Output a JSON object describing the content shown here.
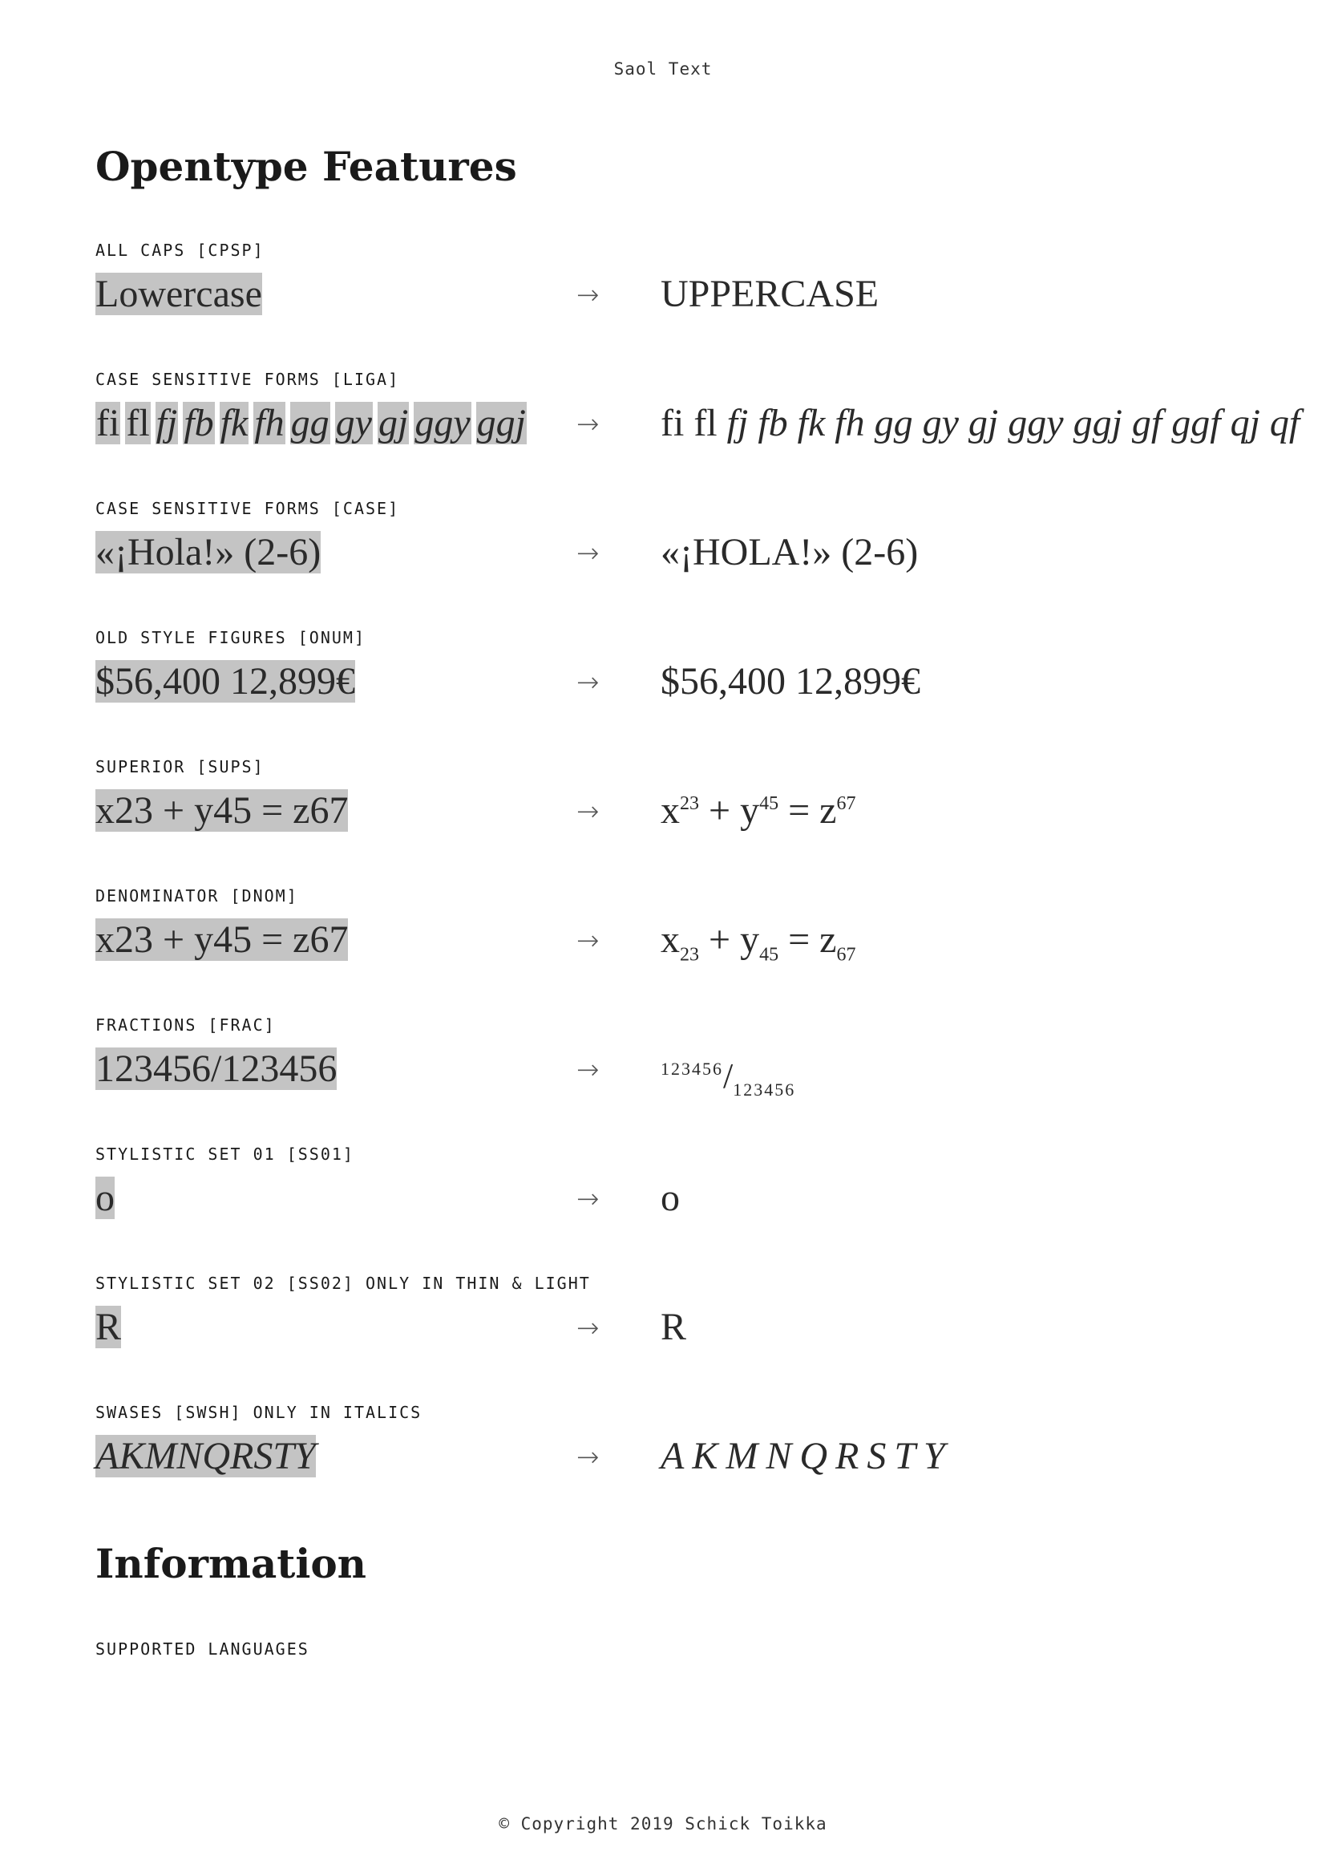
{
  "header": {
    "title": "Saol Text"
  },
  "sections": {
    "opentype": {
      "heading": "Opentype Features"
    },
    "information": {
      "heading": "Information",
      "languages_label": "SUPPORTED LANGUAGES"
    }
  },
  "arrow": "→",
  "features": [
    {
      "label": "ALL CAPS [CPSP]",
      "sample": "Lowercase",
      "result": "UPPERCASE"
    },
    {
      "label": "CASE SENSITIVE FORMS [LIGA]",
      "sample_parts": [
        "fi",
        "fl",
        "fj",
        "fb",
        "fk",
        "fh",
        "gg",
        "gy",
        "gj",
        "ggy",
        "ggj"
      ],
      "result_roman": "fi fl ",
      "result_italic": "fj fb fk fh gg gy gj ggy ggj gf ggf qj qf"
    },
    {
      "label": "CASE SENSITIVE FORMS [CASE]",
      "sample": "«¡Hola!» (2-6)",
      "result": "«¡HOLA!» (2-6)"
    },
    {
      "label": "OLD STYLE FIGURES [ONUM]",
      "sample": "$56,400 12,899€",
      "result": "$56,400 12,899€"
    },
    {
      "label": "SUPERIOR [SUPS]",
      "sample": "x23 + y45 = z67",
      "result_parts": {
        "a": "x",
        "a_sup": "23",
        "op1": " + ",
        "b": "y",
        "b_sup": "45",
        "op2": " = ",
        "c": "z",
        "c_sup": "67"
      }
    },
    {
      "label": "DENOMINATOR [DNOM]",
      "sample": "x23 + y45 = z67",
      "result_parts": {
        "a": "x",
        "a_sub": "23",
        "op1": " + ",
        "b": "y",
        "b_sub": "45",
        "op2": " = ",
        "c": "z",
        "c_sub": "67"
      }
    },
    {
      "label": "FRACTIONS [FRAC]",
      "sample": "123456/123456",
      "result_parts": {
        "num": "123456",
        "slash": "/",
        "den": "123456"
      }
    },
    {
      "label": "STYLISTIC SET 01 [SS01]",
      "sample": "o",
      "result": "o"
    },
    {
      "label": "STYLISTIC SET 02 [SS02] ONLY IN THIN & LIGHT",
      "sample": "R",
      "result": "R"
    },
    {
      "label": "SWASES [SWSH] ONLY IN ITALICS",
      "sample": "AKMNQRSTY",
      "result": "AKMNQRSTY"
    }
  ],
  "footer": {
    "text": "© Copyright 2019 Schick Toikka"
  }
}
